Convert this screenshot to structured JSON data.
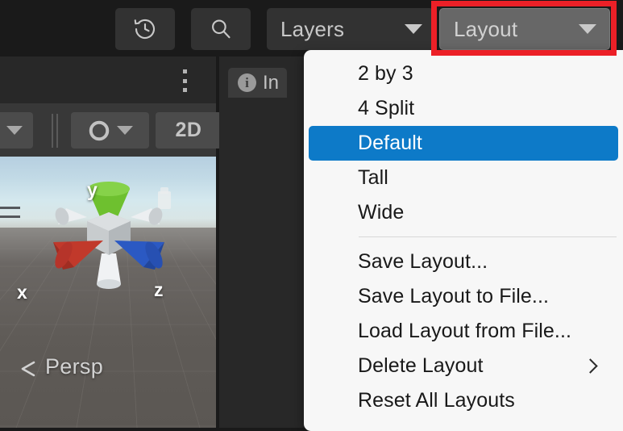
{
  "toolbar": {
    "history_icon": "history-clock-icon",
    "search_icon": "search-magnifier-icon",
    "layers_label": "Layers",
    "layers_caret_icon": "chevron-down-icon",
    "layout_label": "Layout",
    "layout_caret_icon": "chevron-down-icon",
    "highlight_color": "#ec2027"
  },
  "scene_panel": {
    "kebab_icon": "kebab-menu-icon",
    "toolbar": {
      "dropdown_caret_icon": "chevron-down-icon",
      "divider_icon": "vertical-divider-icon",
      "shading_icon": "shading-mode-icon",
      "shading_caret_icon": "chevron-down-icon",
      "two_d_label": "2D"
    },
    "viewport": {
      "axis_y": "y",
      "axis_x": "x",
      "axis_z": "z",
      "projection_label": "Persp",
      "projection_arrow_icon": "chevron-left-icon",
      "gizmo_icon": "axis-gizmo-icon",
      "light_icon": "directional-light-gizmo-icon"
    }
  },
  "inspector_panel": {
    "tab_info_icon": "info-circle-icon",
    "tab_label": "In"
  },
  "layout_menu": {
    "groups": [
      {
        "items": [
          {
            "label": "2 by 3",
            "selected": false,
            "submenu": false
          },
          {
            "label": "4 Split",
            "selected": false,
            "submenu": false
          },
          {
            "label": "Default",
            "selected": true,
            "submenu": false
          },
          {
            "label": "Tall",
            "selected": false,
            "submenu": false
          },
          {
            "label": "Wide",
            "selected": false,
            "submenu": false
          }
        ]
      },
      {
        "items": [
          {
            "label": "Save Layout...",
            "selected": false,
            "submenu": false
          },
          {
            "label": "Save Layout to File...",
            "selected": false,
            "submenu": false
          },
          {
            "label": "Load Layout from File...",
            "selected": false,
            "submenu": false
          },
          {
            "label": "Delete Layout",
            "selected": false,
            "submenu": true
          },
          {
            "label": "Reset All Layouts",
            "selected": false,
            "submenu": false
          }
        ]
      }
    ],
    "selected_color": "#0d7ac8",
    "submenu_icon": "chevron-right-icon"
  }
}
